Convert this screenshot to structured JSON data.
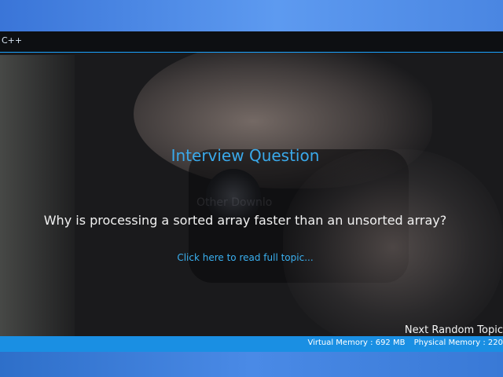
{
  "window": {
    "title": "C++"
  },
  "main": {
    "heading": "Interview Question",
    "question": "Why is processing a sorted array faster than an unsorted array?",
    "read_link": "Click here to read full topic...",
    "next_link": "Next Random Topic"
  },
  "status": {
    "virtual_memory": "Virtual Memory : 692 MB",
    "physical_memory": "Physical Memory : 220"
  },
  "background_text": {
    "other_downloads": "Other Downlo"
  },
  "colors": {
    "accent": "#1aa3ff",
    "heading": "#3aa9ea",
    "statusbar": "#1a8fe3",
    "window_bg": "#1a1a1c"
  }
}
